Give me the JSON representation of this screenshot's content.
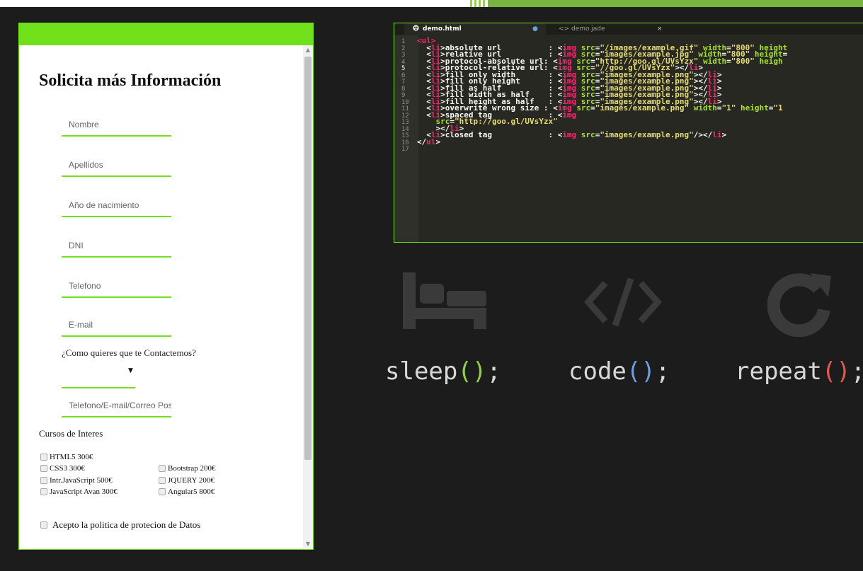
{
  "colors": {
    "accent_green": "#6fe01a",
    "background": "#1c1c1c",
    "editor_bg": "#272822",
    "paren_green": "#8fd24a",
    "paren_blue": "#6a9fe0",
    "paren_red": "#e05a4e"
  },
  "form": {
    "title": "Solicita más Información",
    "fields": {
      "nombre": "Nombre",
      "apellidos": "Apellidos",
      "nacimiento": "Año de nacimiento",
      "dni": "DNI",
      "telefono": "Telefono",
      "email": "E-mail",
      "contacto": "Telefono/E-mail/Correo Pos"
    },
    "contact_question": "¿Como quieres que te Contactemos?",
    "select_caret": "▼",
    "courses_title": "Cursos de Interes",
    "courses": {
      "html5": "HTML5 300€",
      "css3": "CSS3 300€",
      "bootstrap": "Bootstrap 200€",
      "intro_js": "Intr.JavaScript 500€",
      "jquery": "JQUERY 200€",
      "js_avan": "JavaScript Avan 300€",
      "angular": "Angular5 800€"
    },
    "privacy_label": "Acepto la politica de protecion de Datos",
    "scroll_up": "▲",
    "scroll_down": "▼"
  },
  "editor": {
    "tabs": {
      "active": {
        "icon": "html5-file-icon",
        "label": "demo.html",
        "modified_dot": "●"
      },
      "inactive": {
        "icon": "code-brackets-icon",
        "glyph": "<>",
        "label": "demo.jade",
        "close": "×"
      }
    },
    "line_numbers": [
      "1",
      "2",
      "3",
      "4",
      "5",
      "6",
      "7",
      "8",
      "9",
      "10",
      "11",
      "12",
      "13",
      "14",
      "15",
      "16",
      "17"
    ],
    "active_line": "5",
    "code": [
      [
        [
          "tg",
          "<ul>"
        ]
      ],
      [
        [
          "",
          "  <"
        ],
        [
          "tg",
          "li"
        ],
        [
          "",
          ">absolute url          : <"
        ],
        [
          "tg",
          "img"
        ],
        [
          "at",
          " src"
        ],
        [
          "",
          "="
        ],
        [
          "st",
          "\"/images/example.gif\""
        ],
        [
          "at",
          " width"
        ],
        [
          "",
          "="
        ],
        [
          "st",
          "\"800\""
        ],
        [
          "at",
          " height"
        ]
      ],
      [
        [
          "",
          "  <"
        ],
        [
          "tg",
          "li"
        ],
        [
          "",
          ">relative url          : <"
        ],
        [
          "tg",
          "img"
        ],
        [
          "at",
          " src"
        ],
        [
          "",
          "="
        ],
        [
          "st",
          "\"images/example.jpg\""
        ],
        [
          "at",
          " width"
        ],
        [
          "",
          "="
        ],
        [
          "st",
          "\"800\""
        ],
        [
          "at",
          " height"
        ],
        [
          "",
          "="
        ]
      ],
      [
        [
          "",
          "  <"
        ],
        [
          "tg",
          "li"
        ],
        [
          "",
          ">protocol-absolute url: <"
        ],
        [
          "tg",
          "img"
        ],
        [
          "at",
          " src"
        ],
        [
          "",
          "="
        ],
        [
          "st",
          "\"http://goo.gl/UVsYzx\""
        ],
        [
          "at",
          " width"
        ],
        [
          "",
          "="
        ],
        [
          "st",
          "\"800\""
        ],
        [
          "at",
          " heigh"
        ]
      ],
      [
        [
          "",
          "  <"
        ],
        [
          "tg",
          "li"
        ],
        [
          "",
          ">protocol-relative url: <"
        ],
        [
          "tg",
          "img"
        ],
        [
          "at",
          " src"
        ],
        [
          "",
          "="
        ],
        [
          "st",
          "\"//goo.gl/UVsYzx\""
        ],
        [
          "",
          "></"
        ],
        [
          "tg",
          "li"
        ],
        [
          "",
          ">"
        ]
      ],
      [
        [
          "",
          "  <"
        ],
        [
          "tg",
          "li"
        ],
        [
          "",
          ">fill only width       : <"
        ],
        [
          "tg",
          "img"
        ],
        [
          "at",
          " src"
        ],
        [
          "",
          "="
        ],
        [
          "st",
          "\"images/example.png\""
        ],
        [
          "",
          "></"
        ],
        [
          "tg",
          "li"
        ],
        [
          "",
          ">"
        ]
      ],
      [
        [
          "",
          "  <"
        ],
        [
          "tg",
          "li"
        ],
        [
          "",
          ">fill only height      : <"
        ],
        [
          "tg",
          "img"
        ],
        [
          "at",
          " src"
        ],
        [
          "",
          "="
        ],
        [
          "st",
          "\"images/example.png\""
        ],
        [
          "",
          "></"
        ],
        [
          "tg",
          "li"
        ],
        [
          "",
          ">"
        ]
      ],
      [
        [
          "",
          "  <"
        ],
        [
          "tg",
          "li"
        ],
        [
          "",
          ">fill as half          : <"
        ],
        [
          "tg",
          "img"
        ],
        [
          "at",
          " src"
        ],
        [
          "",
          "="
        ],
        [
          "st",
          "\"images/example.png\""
        ],
        [
          "",
          "></"
        ],
        [
          "tg",
          "li"
        ],
        [
          "",
          ">"
        ]
      ],
      [
        [
          "",
          "  <"
        ],
        [
          "tg",
          "li"
        ],
        [
          "",
          ">fill width as half    : <"
        ],
        [
          "tg",
          "img"
        ],
        [
          "at",
          " src"
        ],
        [
          "",
          "="
        ],
        [
          "st",
          "\"images/example.png\""
        ],
        [
          "",
          "></"
        ],
        [
          "tg",
          "li"
        ],
        [
          "",
          ">"
        ]
      ],
      [
        [
          "",
          "  <"
        ],
        [
          "tg",
          "li"
        ],
        [
          "",
          ">fill height as half   : <"
        ],
        [
          "tg",
          "img"
        ],
        [
          "at",
          " src"
        ],
        [
          "",
          "="
        ],
        [
          "st",
          "\"images/example.png\""
        ],
        [
          "",
          "></"
        ],
        [
          "tg",
          "li"
        ],
        [
          "",
          ">"
        ]
      ],
      [
        [
          "",
          "  <"
        ],
        [
          "tg",
          "li"
        ],
        [
          "",
          ">overwrite wrong size : <"
        ],
        [
          "tg",
          "img"
        ],
        [
          "at",
          " src"
        ],
        [
          "",
          "="
        ],
        [
          "st",
          "\"images/example.png\""
        ],
        [
          "at",
          " width"
        ],
        [
          "",
          "="
        ],
        [
          "st",
          "\"1\""
        ],
        [
          "at",
          " height"
        ],
        [
          "",
          "="
        ],
        [
          "st",
          "\"1"
        ]
      ],
      [
        [
          "",
          "  <"
        ],
        [
          "tg",
          "li"
        ],
        [
          "",
          ">spaced tag            : <"
        ],
        [
          "tg",
          "img"
        ]
      ],
      [
        [
          "",
          "    "
        ],
        [
          "at",
          "src"
        ],
        [
          "",
          "="
        ],
        [
          "st",
          "\"http://goo.gl/UVsYzx\""
        ]
      ],
      [
        [
          "",
          "    ></"
        ],
        [
          "tg",
          "li"
        ],
        [
          "",
          ">"
        ]
      ],
      [
        [
          "",
          "  <"
        ],
        [
          "tg",
          "li"
        ],
        [
          "",
          ">closed tag            : <"
        ],
        [
          "tg",
          "img"
        ],
        [
          "at",
          " src"
        ],
        [
          "",
          "="
        ],
        [
          "st",
          "\"images/example.png\""
        ],
        [
          "",
          "/></"
        ],
        [
          "tg",
          "li"
        ],
        [
          "",
          ">"
        ]
      ],
      [
        [
          "",
          "</"
        ],
        [
          "tg",
          "ul"
        ],
        [
          "",
          ">"
        ]
      ],
      [
        [
          "",
          ""
        ]
      ]
    ]
  },
  "motto": {
    "items": [
      {
        "icon": "bed-icon",
        "word": "sleep",
        "paren": "()",
        "semicolon": ";"
      },
      {
        "icon": "code-icon",
        "glyph": "</>",
        "word": "code",
        "paren": "()",
        "semicolon": ";"
      },
      {
        "icon": "refresh-icon",
        "word": "repeat",
        "paren": "()",
        "semicolon": ";"
      }
    ]
  }
}
